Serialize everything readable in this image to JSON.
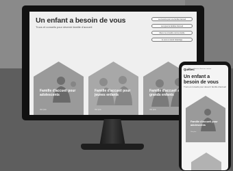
{
  "desktop": {
    "title": "Un enfant a besoin de vous",
    "subtitle": "Trucs et conseils pour devenir famille d'accueil",
    "links": [
      {
        "label": "Les besoins pour une famille d'accueil"
      },
      {
        "label": "Les types de familles d'accueil"
      },
      {
        "label": "Mieux me connaître comme famille"
      },
      {
        "label": "Je veux en savoir davantage"
      }
    ],
    "cards": [
      {
        "label": "Famille d'accueil pour adolescents",
        "more": "Voir plus"
      },
      {
        "label": "Famille d'accueil pour jeunes enfants",
        "more": "Voir plus"
      },
      {
        "label": "Famille d'accueil avec de grands enfants",
        "more": "Voir plus"
      }
    ]
  },
  "phone": {
    "logo": "Québec",
    "tagline": "Santé et Services sociaux",
    "title": "Un enfant a besoin de vous",
    "subtitle": "Trucs et conseils pour devenir famille d'accueil",
    "card": {
      "label": "Famille d'accueil pour adolescents",
      "more": "Voir plus"
    }
  },
  "colors": {
    "card_fill": "#9a9a9a",
    "screen_bg": "#efefef",
    "frame": "#111111"
  }
}
